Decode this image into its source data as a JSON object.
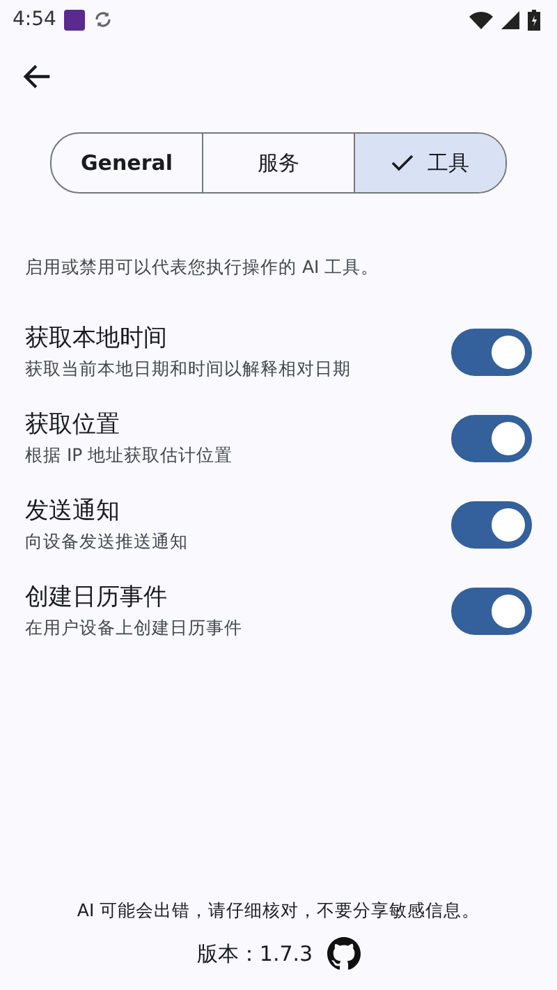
{
  "status_bar": {
    "time": "4:54"
  },
  "tabs": [
    {
      "label": "General",
      "selected": false
    },
    {
      "label": "服务",
      "selected": false
    },
    {
      "label": "工具",
      "selected": true
    }
  ],
  "description": "启用或禁用可以代表您执行操作的 AI 工具。",
  "tools": [
    {
      "title": "获取本地时间",
      "subtitle": "获取当前本地日期和时间以解释相对日期",
      "on": true
    },
    {
      "title": "获取位置",
      "subtitle": "根据 IP 地址获取估计位置",
      "on": true
    },
    {
      "title": "发送通知",
      "subtitle": "向设备发送推送通知",
      "on": true
    },
    {
      "title": "创建日历事件",
      "subtitle": "在用户设备上创建日历事件",
      "on": true
    }
  ],
  "footer": {
    "disclaimer": "AI 可能会出错，请仔细核对，不要分享敏感信息。",
    "version": "版本：1.7.3"
  }
}
